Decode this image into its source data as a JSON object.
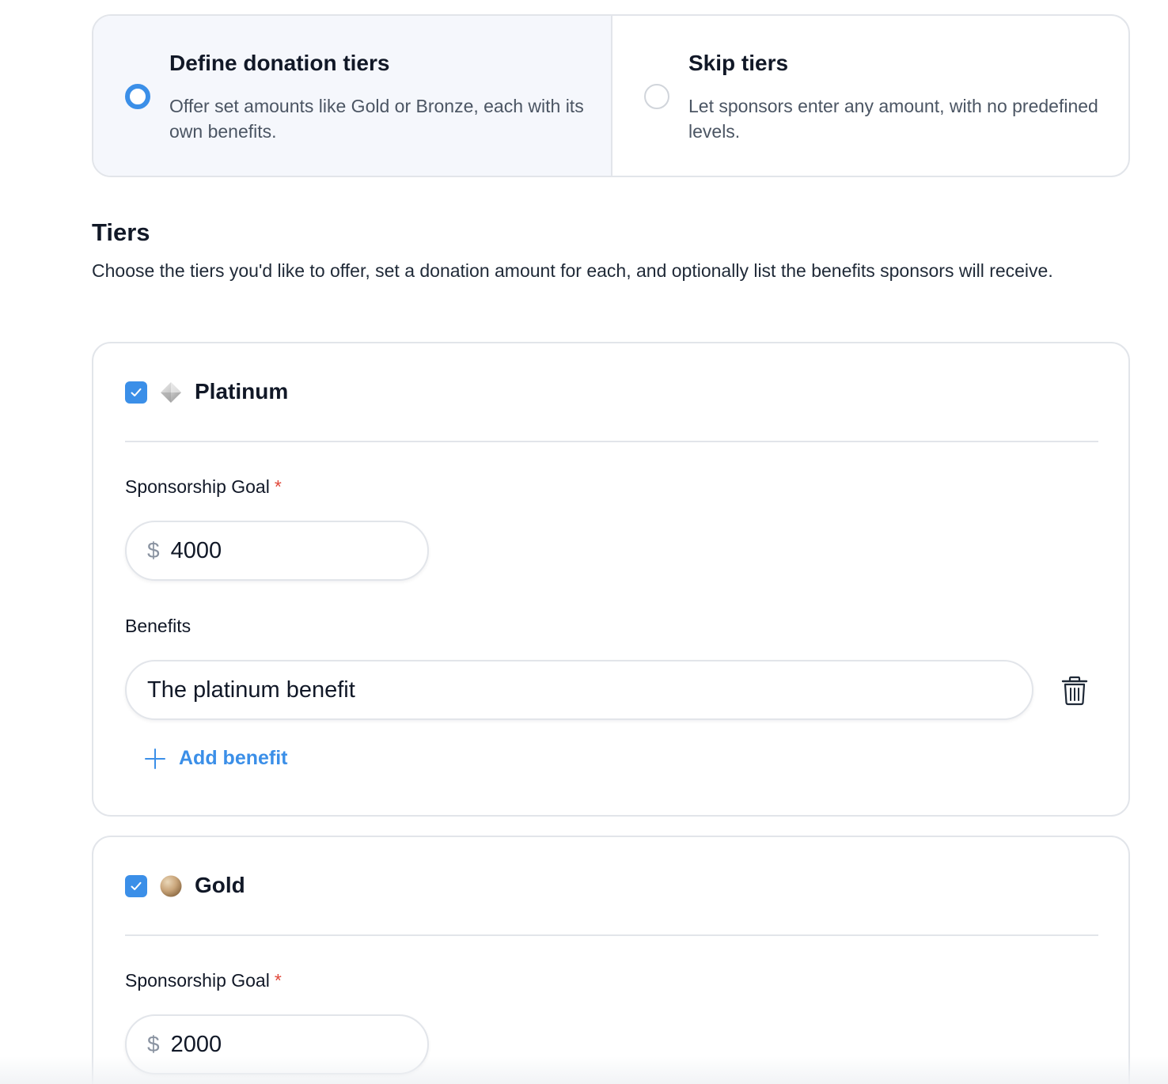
{
  "tier_mode": {
    "options": [
      {
        "title": "Define donation tiers",
        "description": "Offer set amounts like Gold or Bronze, each with its own benefits.",
        "selected": true
      },
      {
        "title": "Skip tiers",
        "description": "Let sponsors enter any amount, with no predefined levels.",
        "selected": false
      }
    ]
  },
  "tiers_section": {
    "title": "Tiers",
    "description": "Choose the tiers you'd like to offer, set a donation amount for each, and optionally list the benefits sponsors will receive."
  },
  "tiers": [
    {
      "name": "Platinum",
      "icon": "diamond-icon",
      "checked": true,
      "goal_label": "Sponsorship Goal",
      "required_marker": "*",
      "currency_symbol": "$",
      "goal_value": "4000",
      "benefits_label": "Benefits",
      "benefits": [
        "The platinum benefit"
      ],
      "add_benefit_label": "Add benefit"
    },
    {
      "name": "Gold",
      "icon": "gold-medal-icon",
      "checked": true,
      "goal_label": "Sponsorship Goal",
      "required_marker": "*",
      "currency_symbol": "$",
      "goal_value": "2000"
    }
  ],
  "colors": {
    "accent": "#3b8fe8",
    "required": "#e0483a",
    "border": "#e2e5ea",
    "selected_bg": "#f5f7fc"
  }
}
